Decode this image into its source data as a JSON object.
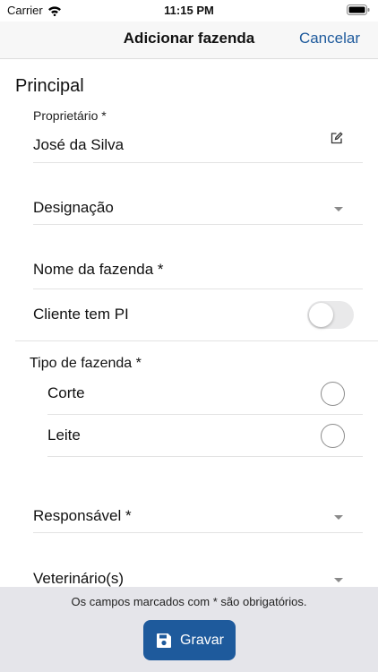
{
  "status_bar": {
    "carrier": "Carrier",
    "time": "11:15 PM",
    "wifi_icon": "wifi-icon",
    "battery_icon": "battery-icon"
  },
  "nav": {
    "title": "Adicionar fazenda",
    "cancel_label": "Cancelar"
  },
  "section": {
    "title": "Principal"
  },
  "fields": {
    "owner": {
      "label": "Proprietário *",
      "value": "José da Silva",
      "icon": "edit-icon"
    },
    "designation": {
      "label": "Designação",
      "icon": "chevron-down-icon"
    },
    "farm_name": {
      "label": "Nome da fazenda *"
    },
    "client_pi": {
      "label": "Cliente tem PI",
      "checked": false
    },
    "farm_type": {
      "label": "Tipo de fazenda *",
      "options": [
        {
          "label": "Corte",
          "selected": false
        },
        {
          "label": "Leite",
          "selected": false
        }
      ]
    },
    "responsible": {
      "label": "Responsável *",
      "icon": "chevron-down-icon"
    },
    "veterinarian": {
      "label": "Veterinário(s)",
      "icon": "chevron-down-icon"
    }
  },
  "footer": {
    "note": "Os campos marcados com * são obrigatórios.",
    "save_label": "Gravar",
    "save_icon": "floppy-disk-icon"
  },
  "colors": {
    "accent": "#1e5a9c",
    "footer_bg": "#e5e5ea",
    "nav_bg": "#f7f7f7"
  }
}
